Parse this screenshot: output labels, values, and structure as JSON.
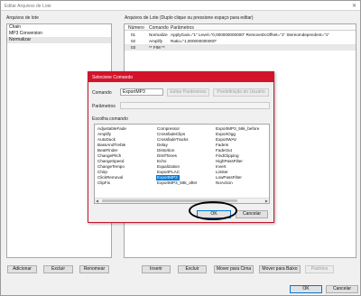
{
  "window": {
    "title": "Editar Arquivos de Lote",
    "close_glyph": "✕"
  },
  "left": {
    "label": "Arquivos de lote",
    "items": [
      "Chain",
      "MP3 Conversion",
      "Normalizar"
    ],
    "selected": 2
  },
  "right": {
    "label": "Arquivos de Lote (Duplo clique ou pressione espaço para editar)",
    "columns": [
      "Número",
      "Comando",
      "Parâmetros"
    ],
    "rows": [
      {
        "num": "01",
        "cmd": "Normalize",
        "params": "ApplyGain=\"1\" Level=\"0,000000000000\" RemoveDcOffset=\"1\" StereoIndependent=\"1\""
      },
      {
        "num": "02",
        "cmd": "Amplify",
        "params": "Ratio=\"1,000000000000\""
      },
      {
        "num": "03",
        "cmd": "** FIM **",
        "params": ""
      }
    ]
  },
  "modal": {
    "title": "Selecione Comando",
    "command_label": "Comando",
    "command_value": "ExportMP3",
    "edit_params": "Editar Parâmetros",
    "preset_user": "Predefinição do Usuário",
    "params_label": "Parâmetros",
    "params_value": "",
    "choose_label": "Escolha comando",
    "columns": [
      [
        "AdjustableFade",
        "Amplify",
        "AutoDuck",
        "BassAndTreble",
        "BeatFinder",
        "ChangePitch",
        "ChangeSpeed",
        "ChangeTempo",
        "Chirp",
        "ClickRemoval",
        "ClipFix"
      ],
      [
        "Compressor",
        "CrossfadeClips",
        "CrossfadeTracks",
        "Delay",
        "Distortion",
        "DtmfTones",
        "Echo",
        "Equalization",
        "ExportFLAC",
        "ExportMP3",
        "ExportMP3_56k_after"
      ],
      [
        "ExportMP3_56k_before",
        "ExportOgg",
        "ExportWAV",
        "FadeIn",
        "FadeOut",
        "FindClipping",
        "HighPassFilter",
        "Invert",
        "Limiter",
        "LowPassFilter",
        "NoAction"
      ]
    ],
    "selected": "ExportMP3",
    "ok": "OK",
    "cancel": "Cancelar"
  },
  "buttons_left": [
    "Adicionar",
    "Excluir",
    "Renomear"
  ],
  "buttons_right": [
    "Inserir",
    "Excluir",
    "Mover para Cima",
    "Mover para Baixo",
    "Padrões"
  ],
  "footer": {
    "ok": "OK",
    "cancel": "Cancelar"
  }
}
